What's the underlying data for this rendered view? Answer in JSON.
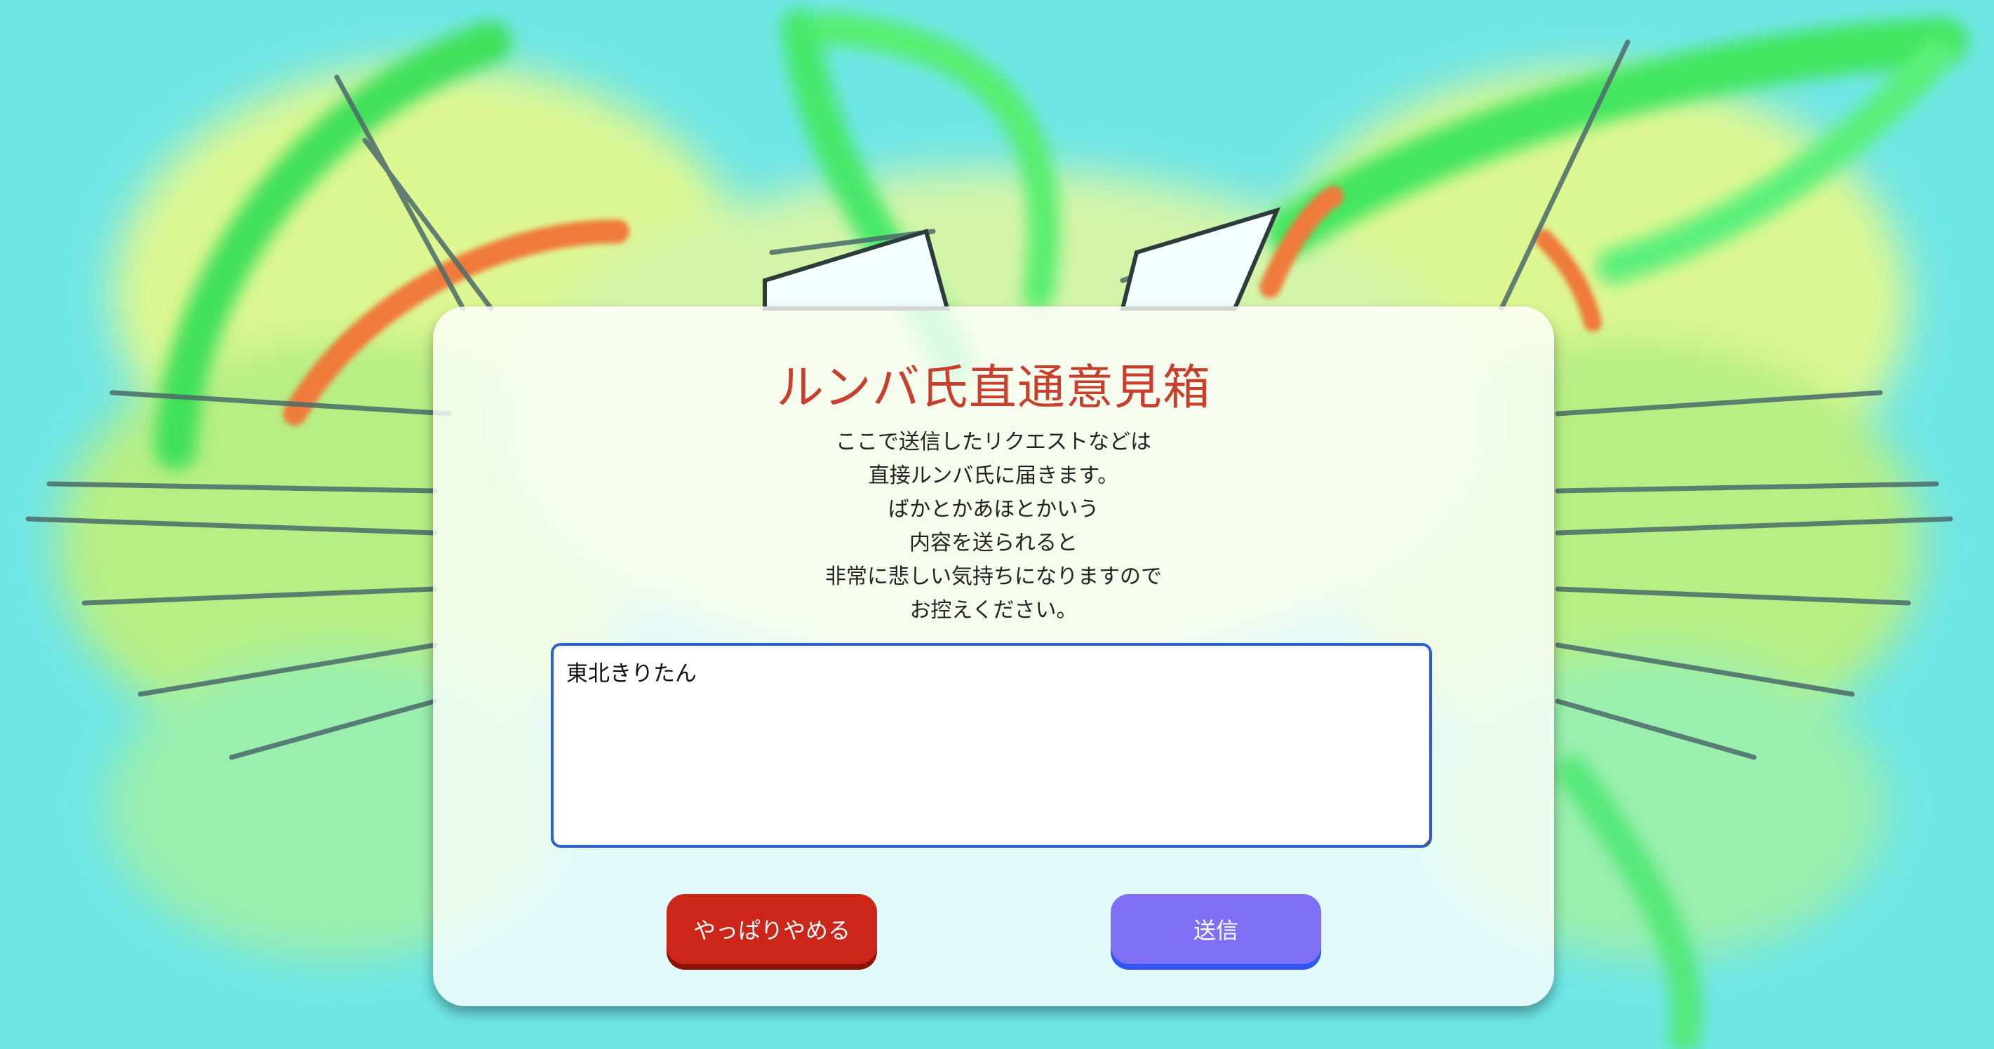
{
  "page": {
    "title": "ルンバ氏直通意見箱",
    "description_lines": [
      "ここで送信したリクエストなどは",
      "直接ルンバ氏に届きます。",
      "ばかとかあほとかいう",
      "内容を送られると",
      "非常に悲しい気持ちになりますので",
      "お控えください。"
    ]
  },
  "form": {
    "message_value": "東北きりたん",
    "cancel_label": "やっぱりやめる",
    "send_label": "送信"
  },
  "colors": {
    "background": "#6fe6e6",
    "title": "#c93f2e",
    "cancel_button": "#cc2519",
    "send_button": "#7f6ff5",
    "textarea_border": "#2b5fd3"
  }
}
